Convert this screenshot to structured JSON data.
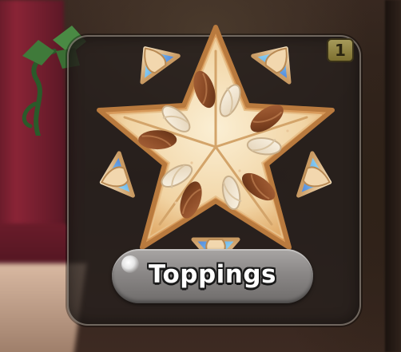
{
  "item_card": {
    "label": "Toppings",
    "count_badge": "1",
    "emblem_icon": "almond-star-topping-icon"
  }
}
